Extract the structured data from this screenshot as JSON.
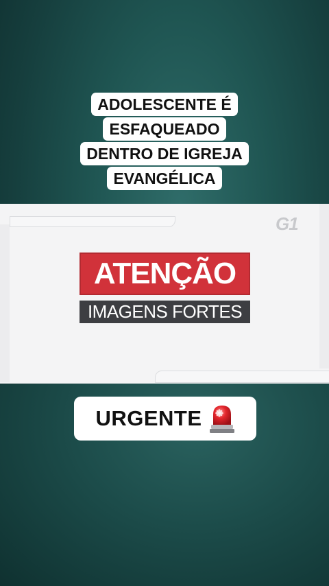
{
  "headline": {
    "lines": [
      "ADOLESCENTE É",
      "ESFAQUEADO",
      "DENTRO DE IGREJA",
      "EVANGÉLICA"
    ]
  },
  "video": {
    "logo": "G1",
    "warning_title": "ATENÇÃO",
    "warning_subtitle": "IMAGENS FORTES",
    "warning_red": "#d1323a",
    "warning_dark": "#3d3e42"
  },
  "urgent": {
    "label": "URGENTE",
    "icon": "police-car-light-icon"
  },
  "colors": {
    "background": "#1f5552",
    "caption_bg": "#ffffff"
  }
}
